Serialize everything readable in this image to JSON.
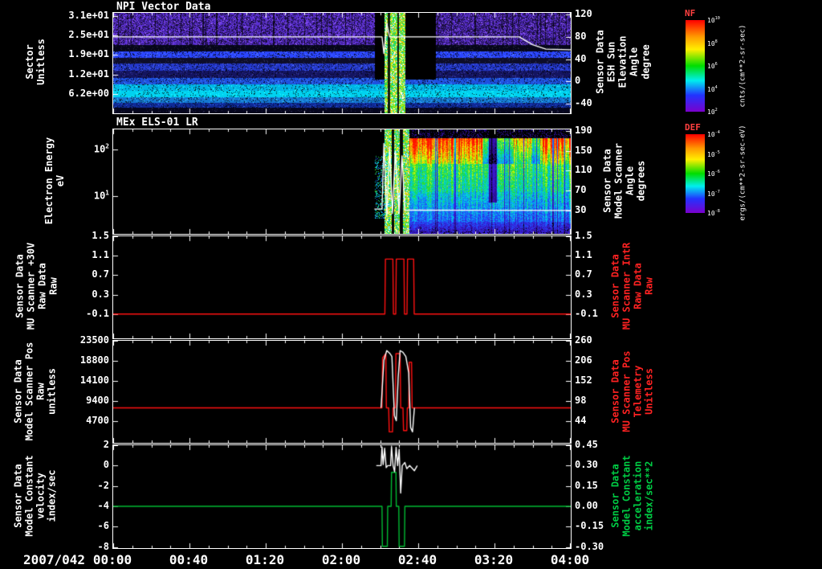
{
  "window": {
    "background": "#000000"
  },
  "chart_data": {
    "x_axis": {
      "date": "2007/042",
      "xlim_minutes": [
        0,
        240
      ],
      "ticks_minutes": [
        0,
        40,
        80,
        120,
        160,
        200,
        240
      ],
      "tick_labels": [
        "00:00",
        "00:40",
        "01:20",
        "02:00",
        "02:40",
        "03:20",
        "04:00"
      ]
    },
    "p1": {
      "type": "heatmap",
      "title": "NPI Vector Data",
      "left_axis": {
        "label": "Sector\nUnitless",
        "ylim": [
          0,
          32
        ],
        "ticks": [
          31,
          24.8,
          18.6,
          12.4,
          6.2
        ],
        "tick_labels": [
          "3.1e+01",
          "2.5e+01",
          "1.9e+01",
          "1.2e+01",
          "6.2e+00"
        ]
      },
      "right_axis": {
        "label": "Sensor Data\nESH Sun\nElevation\nAngle\ndegree",
        "ylim": [
          -57,
          123
        ],
        "ticks": [
          120,
          80,
          40,
          0,
          -40
        ],
        "tick_labels": [
          "120",
          "80",
          "40",
          "0",
          "-40"
        ]
      },
      "colorbar": {
        "title": "NF",
        "unit": "cnts/(cm**2-sr-sec)",
        "tick_labels": [
          "10^10",
          "10^8",
          "10^6",
          "10^4",
          "10^2"
        ]
      },
      "bands": [
        {
          "f0": 0.0,
          "f1": 0.32,
          "color": "#5a2fd2",
          "dark": 0.38
        },
        {
          "f0": 0.32,
          "f1": 0.384,
          "color": "#06061a",
          "dark": 0.0
        },
        {
          "f0": 0.384,
          "f1": 0.448,
          "color": "#2b46ff",
          "dark": 0.15
        },
        {
          "f0": 0.448,
          "f1": 0.504,
          "color": "#0d0d2a",
          "dark": 0.0
        },
        {
          "f0": 0.504,
          "f1": 0.576,
          "color": "#2438cc",
          "dark": 0.2
        },
        {
          "f0": 0.576,
          "f1": 0.648,
          "color": "#141460",
          "dark": 0.1
        },
        {
          "f0": 0.648,
          "f1": 0.712,
          "color": "#1e50e0",
          "dark": 0.15
        },
        {
          "f0": 0.712,
          "f1": 0.776,
          "color": "#00b4e6",
          "dark": 0.1
        },
        {
          "f0": 0.776,
          "f1": 0.84,
          "color": "#00d2f0",
          "dark": 0.08
        },
        {
          "f0": 0.84,
          "f1": 0.896,
          "color": "#1478d2",
          "dark": 0.12
        },
        {
          "f0": 0.896,
          "f1": 0.944,
          "color": "#0f2a96",
          "dark": 0.15
        },
        {
          "f0": 0.944,
          "f1": 1.0,
          "color": "#05051e",
          "dark": 0.0
        }
      ],
      "pregap_minutes": [
        137,
        142
      ],
      "stripe_minutes": [
        142,
        153
      ],
      "gap_minutes": [
        153,
        169
      ],
      "overlay_line": {
        "color": "#ffffff",
        "axis": "right",
        "points": [
          [
            0,
            80
          ],
          [
            141,
            80
          ],
          [
            142,
            50
          ],
          [
            143.5,
            104
          ],
          [
            145,
            80
          ],
          [
            213,
            80
          ],
          [
            220,
            66
          ],
          [
            227,
            58
          ],
          [
            240,
            57
          ]
        ]
      }
    },
    "p2": {
      "type": "heatmap",
      "title": "MEx ELS-01 LR",
      "left_axis": {
        "label": "Electron Energy\neV",
        "scale": "log",
        "ylim": [
          1.5,
          270
        ],
        "ticks": [
          100,
          10
        ],
        "tick_labels": [
          "10^2",
          "10^1"
        ]
      },
      "right_axis": {
        "label": "Sensor Data\nModel Scanner\nAngle\ndegrees",
        "ylim": [
          -17,
          193
        ],
        "ticks": [
          190,
          150,
          110,
          70,
          30
        ],
        "tick_labels": [
          "190",
          "150",
          "110",
          "70",
          "30"
        ]
      },
      "colorbar": {
        "title": "DEF",
        "unit": "ergs/(cm**2-sr-sec-eV)",
        "tick_labels": [
          "10^-4",
          "10^-5",
          "10^-6",
          "10^-7",
          "10^-8"
        ]
      },
      "data_start_minute": 137,
      "stripe_minutes": [
        142,
        155
      ],
      "hot_segments": [
        [
          155,
          194,
          1.0
        ],
        [
          194,
          197,
          0.5
        ],
        [
          197,
          201,
          0.2
        ],
        [
          201,
          210,
          0.45
        ],
        [
          210,
          219,
          0.75
        ],
        [
          219,
          224,
          0.5
        ],
        [
          224,
          240,
          0.95
        ]
      ],
      "dark_gap_minutes": [
        197,
        201
      ],
      "overlay_line": {
        "color": "#ffffff",
        "axis": "right",
        "points": [
          [
            137,
            33
          ],
          [
            141,
            33
          ],
          [
            142,
            165
          ],
          [
            143.5,
            18
          ],
          [
            145,
            158
          ],
          [
            146.5,
            24
          ],
          [
            148,
            150
          ],
          [
            150,
            24
          ],
          [
            151.5,
            140
          ],
          [
            153,
            30
          ],
          [
            155,
            31
          ],
          [
            240,
            30
          ]
        ]
      }
    },
    "p3": {
      "type": "line",
      "left_axis": {
        "label": "Sensor Data\nMU Scanner +30V\nRaw Data\nRaw",
        "ylim": [
          -0.6,
          1.5
        ],
        "ticks": [
          1.5,
          1.1,
          0.7,
          0.3,
          -0.1
        ],
        "tick_labels": [
          "1.5",
          "1.1",
          "0.7",
          "0.3",
          "-0.1"
        ]
      },
      "right_axis": {
        "label": "Sensor Data\nMU Scanner IntR\nRaw Data\nRaw",
        "label_color": "#ff2222",
        "ylim": [
          -0.6,
          1.5
        ],
        "ticks": [
          1.5,
          1.1,
          0.7,
          0.3,
          -0.1
        ],
        "tick_labels": [
          "1.5",
          "1.1",
          "0.7",
          "0.3",
          "-0.1"
        ]
      },
      "series": [
        {
          "name": "MU Scanner IntR Raw Data",
          "color": "#ff1111",
          "axis": "left",
          "points": [
            [
              0,
              -0.1
            ],
            [
              142.5,
              -0.1
            ],
            [
              142.8,
              1.03
            ],
            [
              146.7,
              1.03
            ],
            [
              147,
              -0.1
            ],
            [
              148.2,
              -0.1
            ],
            [
              148.5,
              1.03
            ],
            [
              152.5,
              1.03
            ],
            [
              152.8,
              -0.1
            ],
            [
              154.1,
              -0.1
            ],
            [
              154.4,
              1.03
            ],
            [
              157.6,
              1.03
            ],
            [
              157.9,
              -0.1
            ],
            [
              240,
              -0.1
            ]
          ]
        }
      ]
    },
    "p4": {
      "type": "line",
      "left_axis": {
        "label": "Sensor Data\nModel Scanner Pos\nRaw\nunitless",
        "ylim": [
          -360,
          23500
        ],
        "ticks": [
          23500,
          18800,
          14100,
          9400,
          4700
        ],
        "tick_labels": [
          "23500",
          "18800",
          "14100",
          "9400",
          "4700"
        ]
      },
      "right_axis": {
        "label": "Sensor Data\nMU Scanner Pos\nTelemetry\nUnitless",
        "label_color": "#ff2222",
        "ylim": [
          -14,
          260
        ],
        "ticks": [
          260,
          206,
          152,
          98,
          44
        ],
        "tick_labels": [
          "260",
          "206",
          "152",
          "98",
          "44"
        ]
      },
      "series": [
        {
          "name": "Model Scanner Pos Raw",
          "color": "#ff1111",
          "axis": "left",
          "points": [
            [
              0,
              7800
            ],
            [
              141,
              7800
            ],
            [
              141.3,
              19500
            ],
            [
              143,
              20500
            ],
            [
              143.3,
              7800
            ],
            [
              144.5,
              7800
            ],
            [
              144.8,
              2200
            ],
            [
              146.5,
              2200
            ],
            [
              146.8,
              7800
            ],
            [
              148,
              7800
            ],
            [
              148.3,
              20500
            ],
            [
              150.5,
              20500
            ],
            [
              150.8,
              7800
            ],
            [
              152,
              7800
            ],
            [
              152.3,
              2500
            ],
            [
              154,
              2500
            ],
            [
              154.3,
              7800
            ],
            [
              155,
              7800
            ],
            [
              155.3,
              18500
            ],
            [
              156.5,
              18500
            ],
            [
              156.8,
              7800
            ],
            [
              240,
              7800
            ]
          ]
        },
        {
          "name": "MU Scanner Pos Telemetry",
          "color": "#ffffff",
          "axis": "left",
          "points": [
            [
              140.5,
              7800
            ],
            [
              142,
              19000
            ],
            [
              143.5,
              21200
            ],
            [
              145,
              20600
            ],
            [
              146.2,
              19800
            ],
            [
              147.5,
              6000
            ],
            [
              148.5,
              4800
            ],
            [
              149.5,
              15000
            ],
            [
              150.5,
              21200
            ],
            [
              152,
              20800
            ],
            [
              153.5,
              19800
            ],
            [
              155,
              16000
            ],
            [
              156,
              3200
            ],
            [
              157,
              2200
            ],
            [
              158,
              7800
            ]
          ]
        }
      ]
    },
    "p5": {
      "type": "line",
      "left_axis": {
        "label": "Sensor Data\nModel Constant\nvelocity\nindex/sec",
        "ylim": [
          -8.1,
          2
        ],
        "ticks": [
          2,
          0,
          -2,
          -4,
          -6,
          -8
        ],
        "tick_labels": [
          "2",
          "0",
          "-2",
          "-4",
          "-6",
          "-8"
        ]
      },
      "right_axis": {
        "label": "Sensor Data\nModel Constant\nacceleration\nindex/sec**2",
        "label_color": "#00cc44",
        "ylim": [
          -0.308,
          0.45
        ],
        "ticks": [
          0.45,
          0.3,
          0.15,
          0,
          -0.15,
          -0.3
        ],
        "tick_labels": [
          "0.45",
          "0.30",
          "0.15",
          "0.00",
          "-0.15",
          "-0.30"
        ]
      },
      "series": [
        {
          "name": "Model Constant acceleration",
          "color": "#00bb33",
          "axis": "right",
          "points": [
            [
              0,
              0
            ],
            [
              141,
              0
            ],
            [
              141.2,
              -0.295
            ],
            [
              143.8,
              -0.295
            ],
            [
              144,
              0
            ],
            [
              145.8,
              0
            ],
            [
              146,
              0.25
            ],
            [
              148.3,
              0.25
            ],
            [
              148.5,
              0
            ],
            [
              149.8,
              0
            ],
            [
              150,
              -0.295
            ],
            [
              152.8,
              -0.295
            ],
            [
              153,
              0
            ],
            [
              240,
              0
            ]
          ]
        },
        {
          "name": "Model Constant velocity",
          "color": "#ffffff",
          "axis": "left",
          "points": [
            [
              138,
              0
            ],
            [
              140.5,
              0
            ],
            [
              141,
              1.85
            ],
            [
              141.6,
              0.1
            ],
            [
              142.4,
              1.7
            ],
            [
              143.2,
              -0.2
            ],
            [
              144,
              0
            ],
            [
              145.5,
              0
            ],
            [
              146,
              1.9
            ],
            [
              146.8,
              0
            ],
            [
              147.6,
              -0.6
            ],
            [
              148.4,
              1.8
            ],
            [
              149.2,
              0
            ],
            [
              150,
              1.6
            ],
            [
              150.8,
              -2.7
            ],
            [
              151.6,
              0
            ],
            [
              153,
              0.3
            ],
            [
              154,
              -0.3
            ],
            [
              155.5,
              0
            ],
            [
              158,
              -0.5
            ],
            [
              159.5,
              0
            ]
          ]
        }
      ]
    }
  }
}
